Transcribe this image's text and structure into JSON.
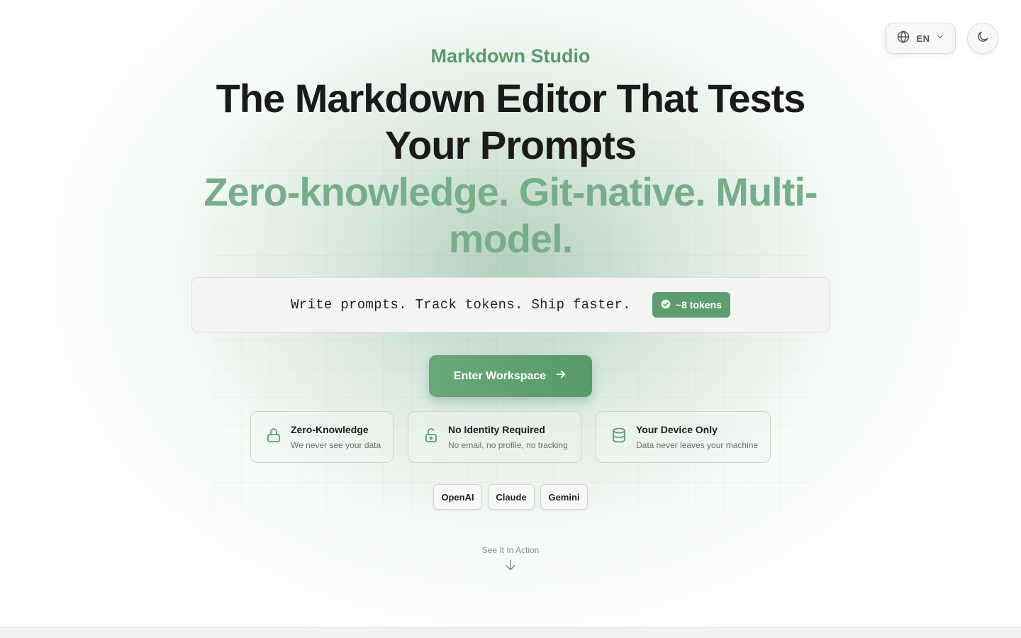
{
  "header": {
    "language_code": "EN"
  },
  "hero": {
    "brand": "Markdown Studio",
    "title": "The Markdown Editor That Tests Your Prompts",
    "subtitle": "Zero-knowledge. Git-native. Multi-model."
  },
  "prompt_demo": {
    "text": "Write prompts. Track tokens. Ship faster.",
    "token_badge": "~8 tokens"
  },
  "cta": {
    "label": "Enter Workspace"
  },
  "features": [
    {
      "title": "Zero-Knowledge",
      "description": "We never see your data",
      "icon": "lock-icon"
    },
    {
      "title": "No Identity Required",
      "description": "No email, no profile, no tracking",
      "icon": "unlock-icon"
    },
    {
      "title": "Your Device Only",
      "description": "Data never leaves your machine",
      "icon": "database-icon"
    }
  ],
  "models": [
    "OpenAI",
    "Claude",
    "Gemini"
  ],
  "scroll_hint": {
    "label": "See It In Action"
  },
  "colors": {
    "accent": "#5a9a6a",
    "subtitle": "#77ae8a",
    "title": "#1a1a1a"
  }
}
